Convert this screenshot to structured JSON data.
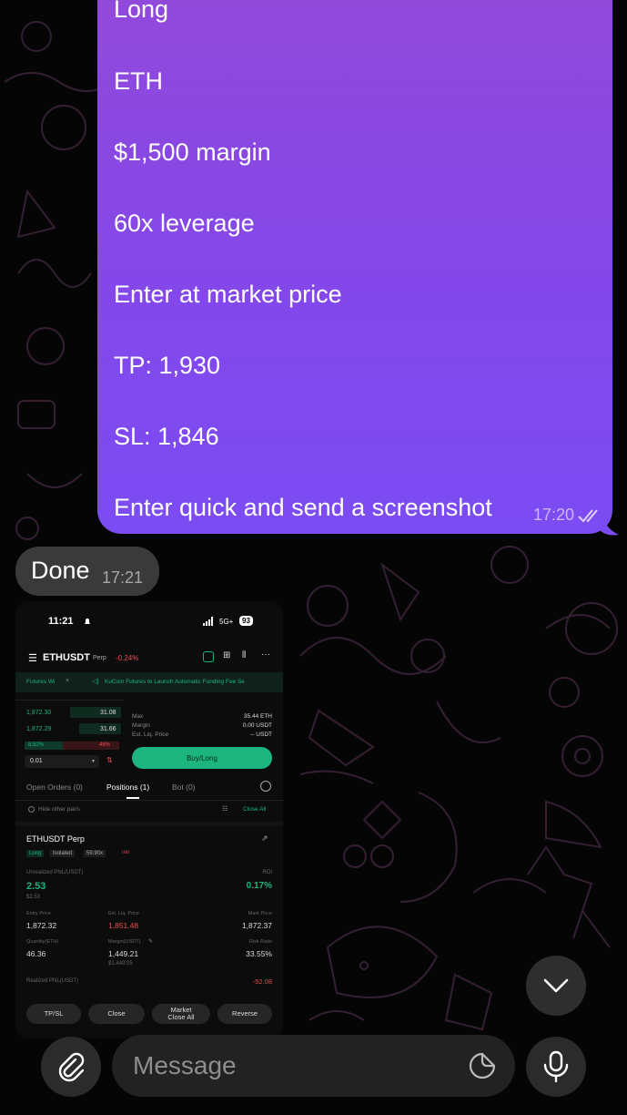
{
  "chat": {
    "outgoing": {
      "lines": [
        "Long",
        "ETH",
        "$1,500 margin",
        "60x leverage",
        "Enter at market price",
        "TP: 1,930",
        "SL: 1,846",
        "Enter quick and send a screenshot"
      ],
      "time": "17:20"
    },
    "incoming": {
      "text": "Done",
      "time": "17:21"
    }
  },
  "screenshot": {
    "status": {
      "time": "11:21",
      "network": "5G+",
      "battery": "93"
    },
    "header": {
      "pair": "ETHUSDT",
      "type": "Perp",
      "change": "-0.24%"
    },
    "banner": {
      "tab": "Futures Wi",
      "close": "×",
      "news": "KuCoin Futures to Launch Automatic Funding Fee Se"
    },
    "orderbook": {
      "rows": [
        {
          "price": "1,872.30",
          "qty": "31.08"
        },
        {
          "price": "1,872.29",
          "qty": "31.66"
        }
      ],
      "buy_pct": "8.52%",
      "sell_pct": "48%",
      "step": "0.01"
    },
    "form": {
      "labels": [
        "Max",
        "Margin",
        "Est. Liq. Price"
      ],
      "values": [
        "35.44 ETH",
        "0.00 USDT",
        "-- USDT"
      ],
      "button": "Buy/Long"
    },
    "tabs": [
      "Open Orders (0)",
      "Positions (1)",
      "Bot (0)"
    ],
    "filter": {
      "hide": "Hide other pairs",
      "close_all": "Close All"
    },
    "position": {
      "name": "ETHUSDT Perp",
      "tags": [
        "Long",
        "Isolated",
        "59.90x"
      ],
      "unrealized_label": "Unrealized PNL(USDT)",
      "unrealized": "2.53",
      "unrealized_sub": "$2.53",
      "roi_label": "ROI",
      "roi": "0.17%",
      "entry_label": "Entry Price",
      "entry": "1,872.32",
      "liq_label": "Est. Liq. Price",
      "liq": "1,851.48",
      "mark_label": "Mark Price",
      "mark": "1,872.37",
      "qty_label": "Quantity(ETH)",
      "qty": "46.36",
      "margin_label": "Margin(USDT)",
      "margin": "1,449.21",
      "margin_sub": "$1,449.05",
      "risk_label": "Risk Ratio",
      "risk": "33.55%",
      "realized_label": "Realized PNL(USDT)",
      "realized": "-52.08"
    },
    "buttons": [
      "TP/SL",
      "Close",
      "Market Close All",
      "Reverse"
    ]
  },
  "composer": {
    "placeholder": "Message"
  },
  "icons": [
    "attach-icon",
    "sticker-icon",
    "mic-icon",
    "chevron-down-icon",
    "double-check-icon"
  ],
  "colors": {
    "bubble_out": "#8448ea",
    "bubble_in": "#3a3a3a",
    "green": "#1db57f",
    "red": "#f0494f"
  }
}
